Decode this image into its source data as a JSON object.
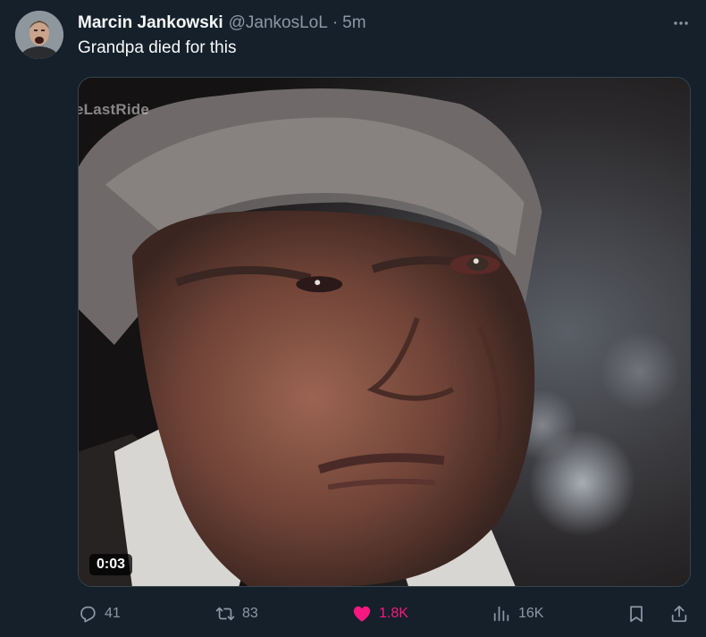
{
  "tweet": {
    "display_name": "Marcin Jankowski",
    "handle": "@JankosLoL",
    "separator": "·",
    "time": "5m",
    "text": "Grandpa died for this",
    "more_icon": "more-horizontal-icon"
  },
  "media": {
    "watermark": "eLastRide",
    "duration": "0:03",
    "type": "video"
  },
  "actions": {
    "replies": "41",
    "retweets": "83",
    "likes": "1.8K",
    "views": "16K",
    "liked": true
  },
  "colors": {
    "background": "#15202b",
    "text_primary": "#f7f9f9",
    "text_secondary": "#8b98a5",
    "like_active": "#f91880",
    "border": "#38444d"
  }
}
